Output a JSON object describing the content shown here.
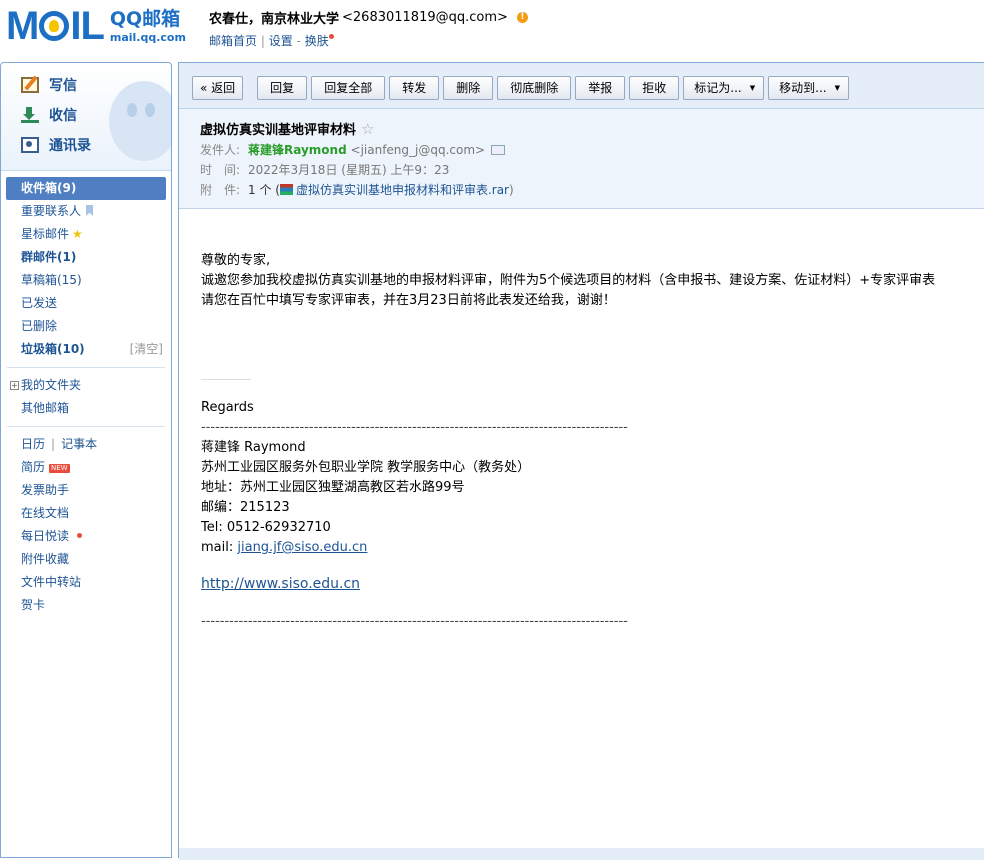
{
  "brand": {
    "logo_text": "MOIL",
    "name": "QQ邮箱",
    "url": "mail.qq.com"
  },
  "user": {
    "display": "农春仕，南京林业大学",
    "email": "<2683011819@qq.com>",
    "links": {
      "home": "邮箱首页",
      "settings": "设置",
      "dash": "-",
      "skin": "换肤"
    }
  },
  "sidebar": {
    "quick": [
      {
        "label": "写信"
      },
      {
        "label": "收信"
      },
      {
        "label": "通讯录"
      }
    ],
    "folders": [
      {
        "label": "收件箱(9)"
      },
      {
        "label": "重要联系人"
      },
      {
        "label": "星标邮件"
      },
      {
        "label": "群邮件(1)"
      },
      {
        "label": "草稿箱(15)"
      },
      {
        "label": "已发送"
      },
      {
        "label": "已删除"
      },
      {
        "label": "垃圾箱(10)",
        "action": "[清空]"
      }
    ],
    "extra": {
      "my_folders": "我的文件夹",
      "other": "其他邮箱"
    },
    "apps": {
      "calendar": "日历",
      "notes": "记事本",
      "resume": "简历",
      "new_badge": "NEW",
      "invoice": "发票助手",
      "docs": "在线文档",
      "daily": "每日悦读",
      "attachments": "附件收藏",
      "transfer": "文件中转站",
      "cards": "贺卡"
    }
  },
  "toolbar": {
    "back": "« 返回",
    "buttons": [
      "回复",
      "回复全部",
      "转发",
      "删除",
      "彻底删除",
      "举报",
      "拒收"
    ],
    "dropdowns": [
      "标记为...",
      "移动到..."
    ]
  },
  "mail": {
    "subject": "虚拟仿真实训基地评审材料",
    "from_label": "发件人:",
    "from_name": "蒋建锋Raymond",
    "from_email": "<jianfeng_j@qq.com>",
    "time_label": "时　间:",
    "time": "2022年3月18日 (星期五) 上午9：23",
    "attach_label": "附　件:",
    "attach_count": "1 个 (",
    "attach_name": "虚拟仿真实训基地申报材料和评审表.rar",
    "attach_close": ")"
  },
  "body": {
    "greeting": "尊敬的专家,",
    "line1": "诚邀您参加我校虚拟仿真实训基地的申报材料评审，附件为5个候选项目的材料（含申报书、建设方案、佐证材料）+专家评审表",
    "line2": "请您在百忙中填写专家评审表，并在3月23日前将此表发还给我，谢谢！",
    "regards": "Regards",
    "dashes": "-------------------------------------------------------------------------------------------",
    "sig_name": "蒋建锋 Raymond",
    "sig_org": "苏州工业园区服务外包职业学院 教学服务中心（教务处）",
    "sig_addr": "地址：苏州工业园区独墅湖高教区若水路99号",
    "sig_zip": "邮编：215123",
    "sig_tel": "Tel:  0512-62932710",
    "sig_mail_label": "mail: ",
    "sig_mail": "jiang.jf@siso.edu.cn",
    "sig_url": "http://www.siso.edu.cn"
  }
}
